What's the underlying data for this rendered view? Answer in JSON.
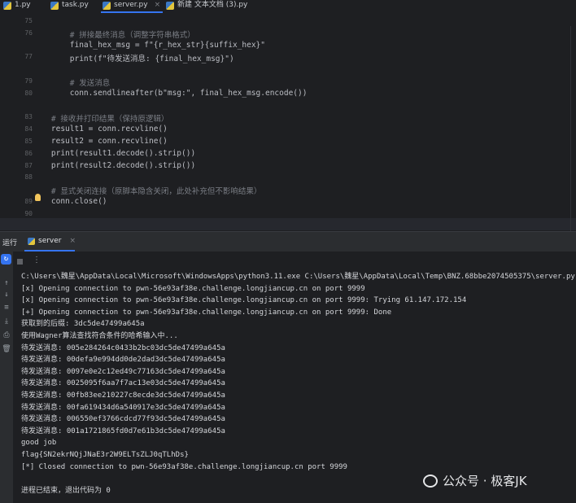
{
  "tabs": [
    {
      "label": "1.py",
      "active": false
    },
    {
      "label": "task.py",
      "active": false
    },
    {
      "label": "server.py",
      "active": true
    },
    {
      "label": "新建 文本文档 (3).py",
      "active": false
    }
  ],
  "editor": {
    "lines": [
      {
        "num": "75",
        "text": "",
        "cls": ""
      },
      {
        "num": "76",
        "text": "        # 拼接最终消息（调整字符串格式）",
        "cls": "comment"
      },
      {
        "num": "",
        "text": "        final_hex_msg = f\"{r_hex_str}{suffix_hex}\"",
        "cls": ""
      },
      {
        "num": "77",
        "text": "        print(f\"待发送消息: {final_hex_msg}\")",
        "cls": ""
      },
      {
        "num": "",
        "text": "",
        "cls": ""
      },
      {
        "num": "79",
        "text": "        # 发送消息",
        "cls": "comment"
      },
      {
        "num": "80",
        "text": "        conn.sendlineafter(b\"msg:\", final_hex_msg.encode())",
        "cls": ""
      },
      {
        "num": "",
        "text": "",
        "cls": ""
      },
      {
        "num": "83",
        "text": "    # 接收并打印结果（保持原逻辑）",
        "cls": "comment"
      },
      {
        "num": "84",
        "text": "    result1 = conn.recvline()",
        "cls": ""
      },
      {
        "num": "85",
        "text": "    result2 = conn.recvline()",
        "cls": ""
      },
      {
        "num": "86",
        "text": "    print(result1.decode().strip())",
        "cls": ""
      },
      {
        "num": "87",
        "text": "    print(result2.decode().strip())",
        "cls": ""
      },
      {
        "num": "88",
        "text": "",
        "cls": ""
      },
      {
        "num": "",
        "text": "    # 显式关闭连接（原脚本隐含关闭，此处补充但不影响结果）",
        "cls": "comment"
      },
      {
        "num": "89",
        "text": "    conn.close()",
        "cls": ""
      },
      {
        "num": "90",
        "text": "",
        "cls": ""
      }
    ]
  },
  "run_panel": {
    "label": "运行",
    "tab_label": "server",
    "console_lines": [
      "C:\\Users\\魏星\\AppData\\Local\\Microsoft\\WindowsApps\\python3.11.exe C:\\Users\\魏星\\AppData\\Local\\Temp\\BNZ.68bbe2074505375\\server.py",
      "[x] Opening connection to pwn-56e93af38e.challenge.longjiancup.cn on port 9999",
      "[x] Opening connection to pwn-56e93af38e.challenge.longjiancup.cn on port 9999: Trying 61.147.172.154",
      "[+] Opening connection to pwn-56e93af38e.challenge.longjiancup.cn on port 9999: Done",
      "获取到的后缀: 3dc5de47499a645a",
      "使用Wagner算法查找符合条件的哈希输入中...",
      "待发送消息: 005e284264c0433b2bc03dc5de47499a645a",
      "待发送消息: 00defa9e994dd0de2dad3dc5de47499a645a",
      "待发送消息: 0097e0e2c12ed49c77163dc5de47499a645a",
      "待发送消息: 0025095f6aa7f7ac13e03dc5de47499a645a",
      "待发送消息: 00fb83ee210227c8ecde3dc5de47499a645a",
      "待发送消息: 00fa619434d6a540917e3dc5de47499a645a",
      "待发送消息: 006550ef3766cdcd77f93dc5de47499a645a",
      "待发送消息: 001a1721865fd0d7e61b3dc5de47499a645a",
      "good job",
      "flag{SN2ekrNQjJNaE3r2W9ELTsZLJ0qTLhDs}",
      "[*] Closed connection to pwn-56e93af38e.challenge.longjiancup.cn port 9999",
      "",
      "进程已结束，退出代码为 0"
    ]
  },
  "watermark": {
    "text": "公众号 · 极客JK"
  },
  "colors": {
    "accent": "#3574f0",
    "background": "#1e1f22",
    "panel": "#2b2d30"
  }
}
